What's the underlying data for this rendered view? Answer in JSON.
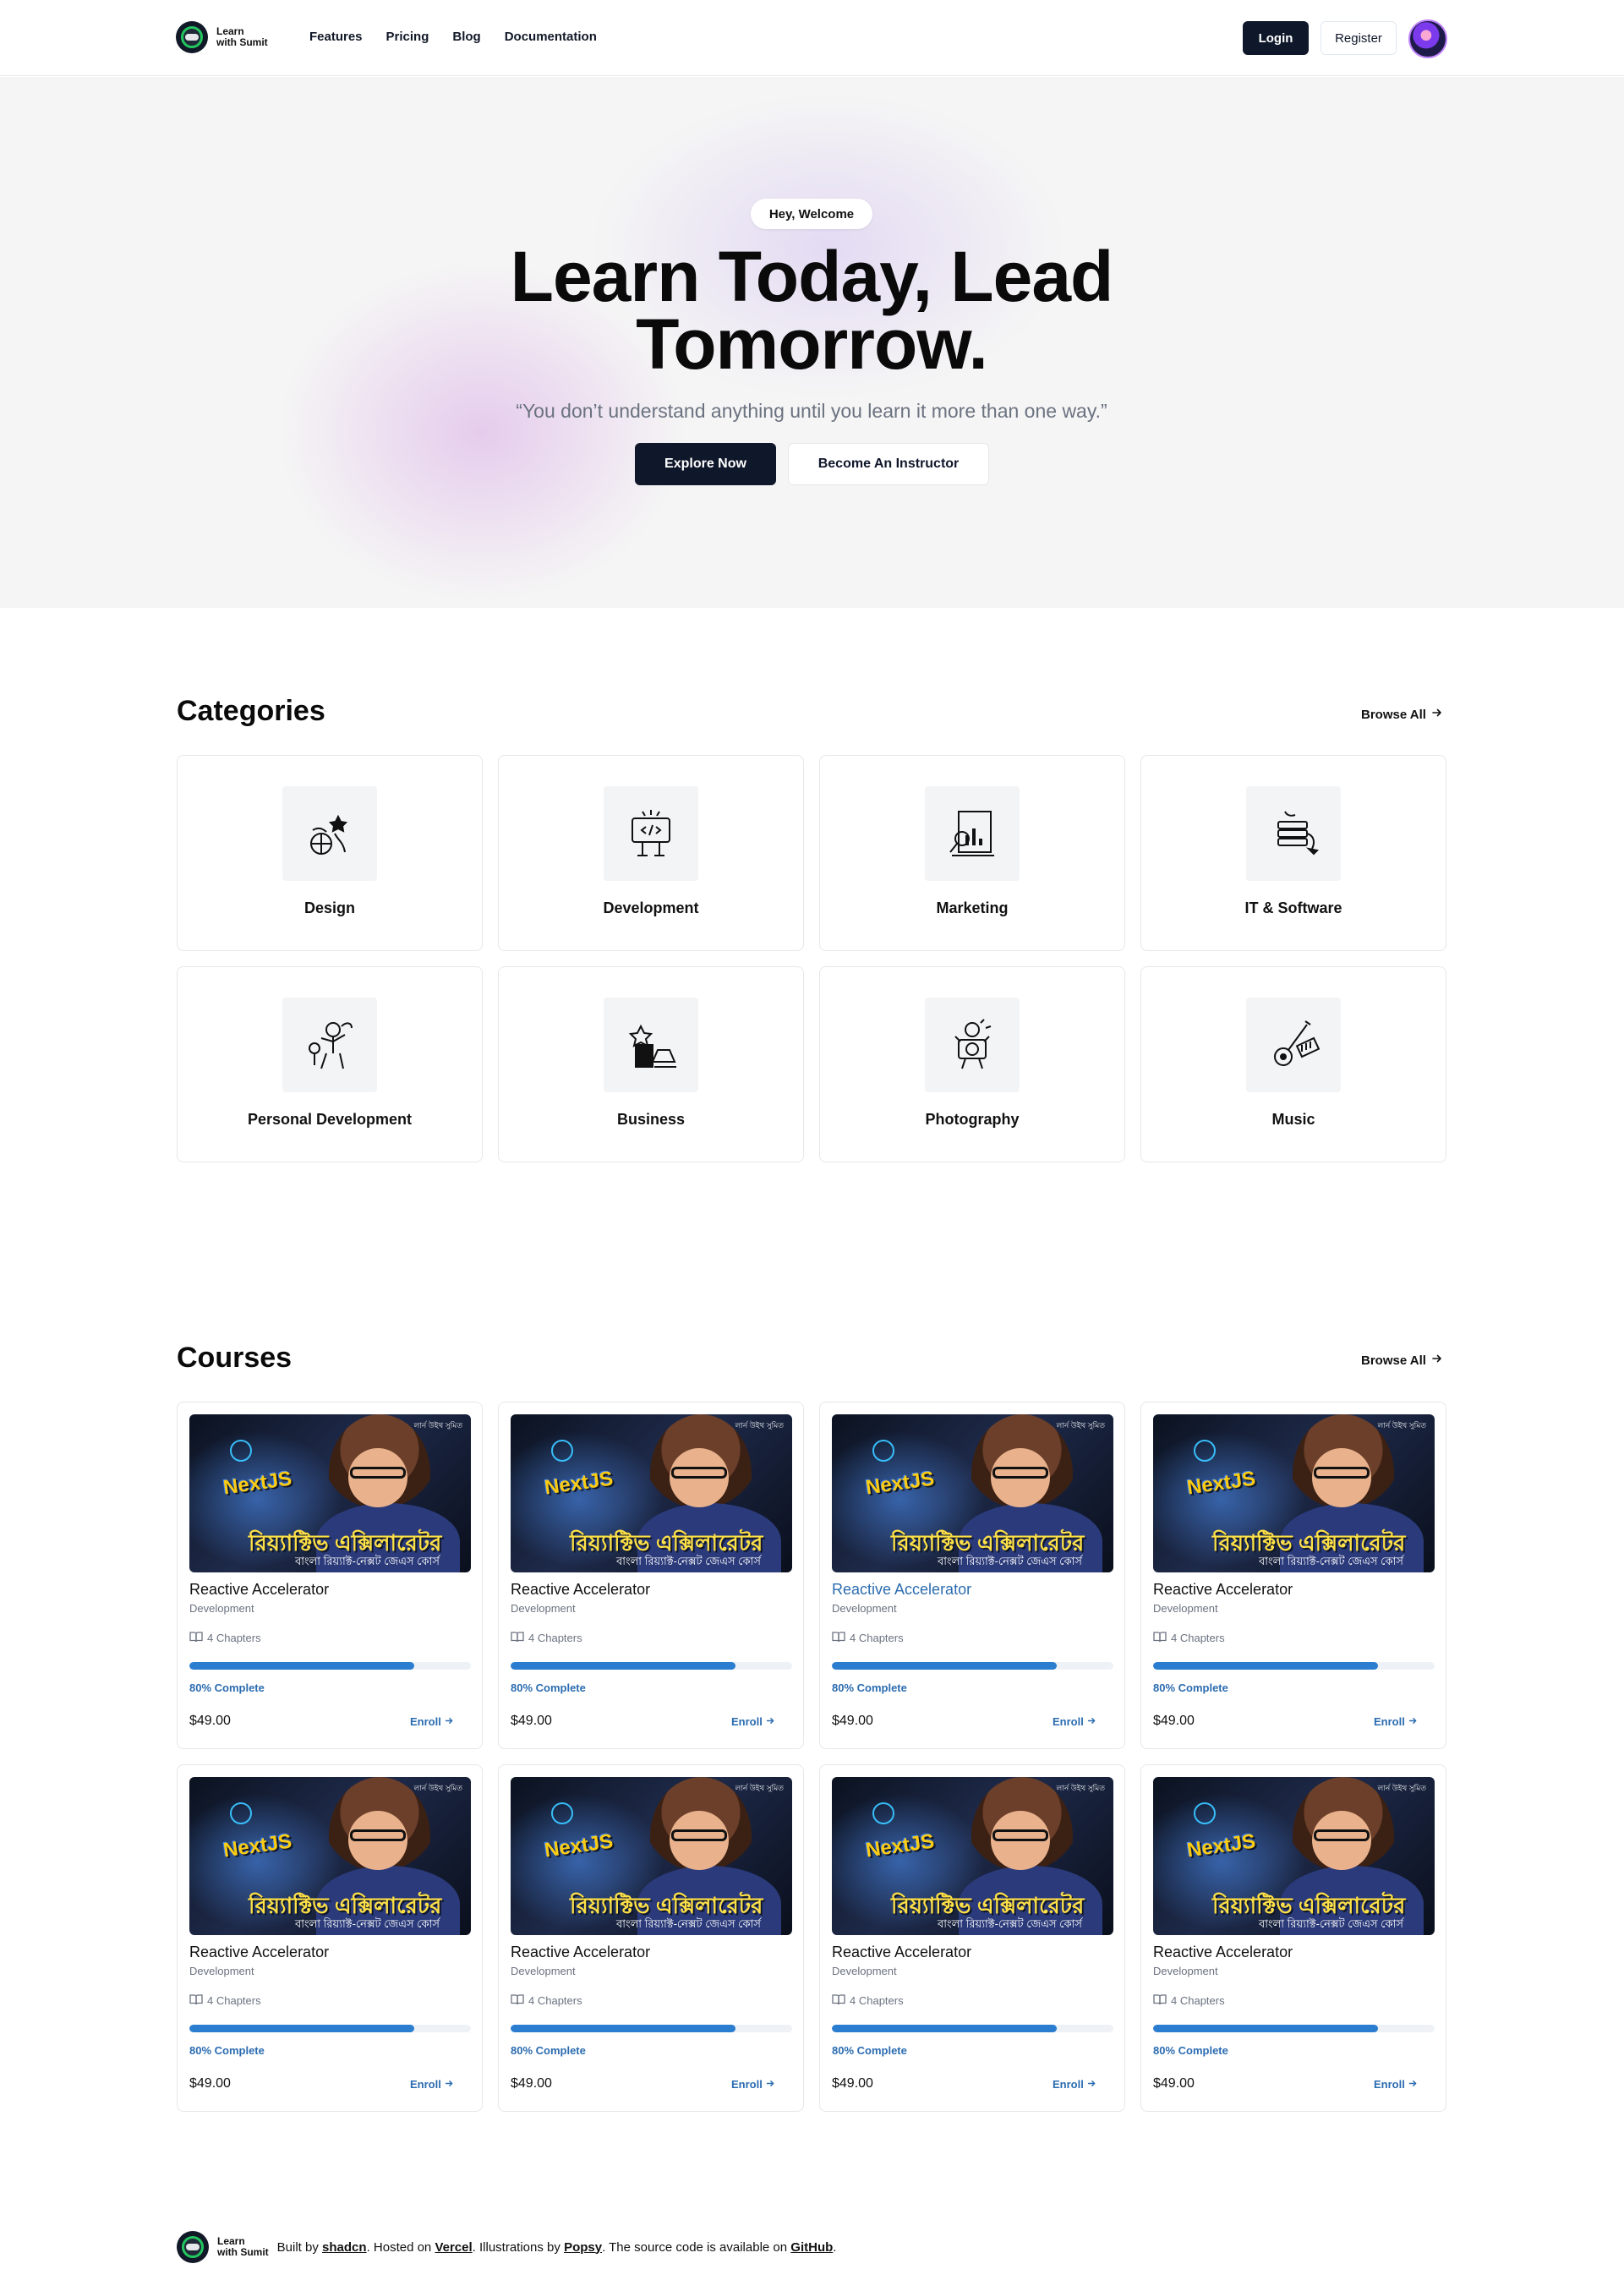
{
  "header": {
    "logo_line1": "Learn",
    "logo_line2": "with Sumit",
    "nav": [
      "Features",
      "Pricing",
      "Blog",
      "Documentation"
    ],
    "login_label": "Login",
    "register_label": "Register"
  },
  "hero": {
    "badge": "Hey, Welcome",
    "title": "Learn Today, Lead Tomorrow.",
    "quote": "“You don’t understand anything until you learn it more than one way.”",
    "primary_cta": "Explore Now",
    "secondary_cta": "Become An Instructor"
  },
  "categories": {
    "heading": "Categories",
    "browse_label": "Browse All",
    "items": [
      {
        "label": "Design",
        "icon": "design-illustration-icon"
      },
      {
        "label": "Development",
        "icon": "development-illustration-icon"
      },
      {
        "label": "Marketing",
        "icon": "marketing-illustration-icon"
      },
      {
        "label": "IT & Software",
        "icon": "it-software-illustration-icon"
      },
      {
        "label": "Personal Development",
        "icon": "personal-development-illustration-icon"
      },
      {
        "label": "Business",
        "icon": "business-illustration-icon"
      },
      {
        "label": "Photography",
        "icon": "photography-illustration-icon"
      },
      {
        "label": "Music",
        "icon": "music-illustration-icon"
      }
    ]
  },
  "courses": {
    "heading": "Courses",
    "browse_label": "Browse All",
    "thumbnail": {
      "next_label": "NextJS",
      "bn_title": "রিয়্যাক্টিভ এক্সিলারেটর",
      "bn_sub": "বাংলা রিয়্যাক্ট-নেক্সট জেএস কোর্স",
      "brand": "লার্ন উইথ সুমিত"
    },
    "items": [
      {
        "title": "Reactive Accelerator",
        "category": "Development",
        "chapters": "4 Chapters",
        "progress": 0.8,
        "complete": "80% Complete",
        "price": "$49.00",
        "enroll": "Enroll",
        "highlight": false
      },
      {
        "title": "Reactive Accelerator",
        "category": "Development",
        "chapters": "4 Chapters",
        "progress": 0.8,
        "complete": "80% Complete",
        "price": "$49.00",
        "enroll": "Enroll",
        "highlight": false
      },
      {
        "title": "Reactive Accelerator",
        "category": "Development",
        "chapters": "4 Chapters",
        "progress": 0.8,
        "complete": "80% Complete",
        "price": "$49.00",
        "enroll": "Enroll",
        "highlight": true
      },
      {
        "title": "Reactive Accelerator",
        "category": "Development",
        "chapters": "4 Chapters",
        "progress": 0.8,
        "complete": "80% Complete",
        "price": "$49.00",
        "enroll": "Enroll",
        "highlight": false
      },
      {
        "title": "Reactive Accelerator",
        "category": "Development",
        "chapters": "4 Chapters",
        "progress": 0.8,
        "complete": "80% Complete",
        "price": "$49.00",
        "enroll": "Enroll",
        "highlight": false
      },
      {
        "title": "Reactive Accelerator",
        "category": "Development",
        "chapters": "4 Chapters",
        "progress": 0.8,
        "complete": "80% Complete",
        "price": "$49.00",
        "enroll": "Enroll",
        "highlight": false
      },
      {
        "title": "Reactive Accelerator",
        "category": "Development",
        "chapters": "4 Chapters",
        "progress": 0.8,
        "complete": "80% Complete",
        "price": "$49.00",
        "enroll": "Enroll",
        "highlight": false
      },
      {
        "title": "Reactive Accelerator",
        "category": "Development",
        "chapters": "4 Chapters",
        "progress": 0.8,
        "complete": "80% Complete",
        "price": "$49.00",
        "enroll": "Enroll",
        "highlight": false
      }
    ]
  },
  "footer": {
    "built_by_prefix": "Built by",
    "built_by_link": "shadcn",
    "hosted_prefix": ". Hosted on",
    "hosted_link": "Vercel",
    "illus_prefix": ". Illustrations by",
    "illus_link": "Popsy",
    "source_prefix": ". The source code is available on",
    "source_link": "GitHub",
    "end": "."
  },
  "colors": {
    "primary_dark": "#0f172a",
    "accent_blue": "#2b6cb0",
    "progress_fill": "#2b7dd0",
    "hero_bg": "#f5f5f5"
  }
}
